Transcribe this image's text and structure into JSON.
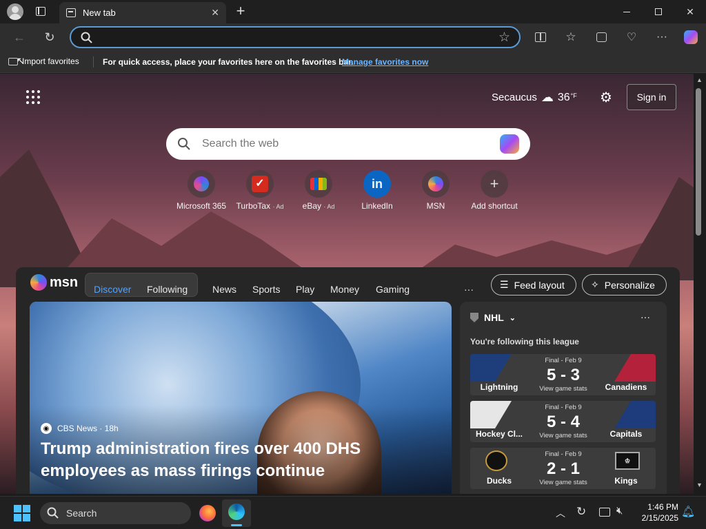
{
  "browser": {
    "tab_title": "New tab",
    "address_value": "",
    "fav_import": "Import favorites",
    "fav_hint": "For quick access, place your favorites here on the favorites bar.",
    "fav_manage": "Manage favorites now"
  },
  "header": {
    "city": "Secaucus",
    "temp": "36",
    "unit": "°F",
    "sign_in": "Sign in"
  },
  "search": {
    "placeholder": "Search the web"
  },
  "shortcuts": [
    {
      "label": "Microsoft 365",
      "ad": ""
    },
    {
      "label": "TurboTax",
      "ad": "· Ad"
    },
    {
      "label": "eBay",
      "ad": "· Ad"
    },
    {
      "label": "LinkedIn",
      "ad": ""
    },
    {
      "label": "MSN",
      "ad": ""
    },
    {
      "label": "Add shortcut",
      "ad": ""
    }
  ],
  "msn": {
    "logo": "msn",
    "tabs": [
      "Discover",
      "Following"
    ],
    "nav": [
      "News",
      "Sports",
      "Play",
      "Money",
      "Gaming"
    ],
    "more": "···",
    "feed_layout": "Feed layout",
    "personalize": "Personalize"
  },
  "hero": {
    "source": "CBS News · 18h",
    "headline": "Trump administration fires over 400 DHS employees as mass firings continue"
  },
  "nhl": {
    "league": "NHL",
    "following": "You're following this league",
    "more": "···",
    "games": [
      {
        "status": "Final - Feb 9",
        "score": "5 - 3",
        "left": "Lightning",
        "right": "Canadiens",
        "link": "View game stats",
        "lcol": "#1d3e7a",
        "rcol": "#b3223a"
      },
      {
        "status": "Final - Feb 9",
        "score": "5 - 4",
        "left": "Hockey Cl...",
        "right": "Capitals",
        "link": "View game stats",
        "lcol": "#e6e6e6",
        "rcol": "#1e3c7c"
      },
      {
        "status": "Final - Feb 9",
        "score": "2 - 1",
        "left": "Ducks",
        "right": "Kings",
        "link": "View game stats",
        "lcol": "#333333",
        "rcol": "#333333"
      }
    ]
  },
  "taskbar": {
    "search": "Search",
    "time": "1:46 PM",
    "date": "2/15/2025"
  },
  "colors": {
    "accent": "#5b9bd5",
    "msn_active": "#4fa3ff"
  }
}
